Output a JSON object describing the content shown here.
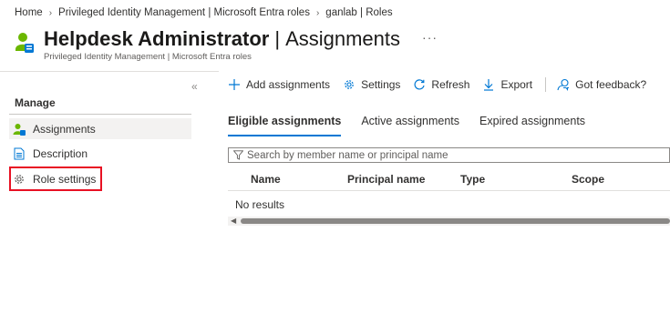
{
  "breadcrumb": {
    "items": [
      "Home",
      "Privileged Identity Management | Microsoft Entra roles",
      "ganlab | Roles"
    ],
    "separator": "›"
  },
  "header": {
    "title_strong": "Helpdesk Administrator",
    "title_pipe": "|",
    "title_rest": "Assignments",
    "more": "···",
    "subtitle": "Privileged Identity Management | Microsoft Entra roles"
  },
  "sidebar": {
    "collapse": "«",
    "manage_label": "Manage",
    "items": [
      {
        "label": "Assignments",
        "icon": "user-group-icon"
      },
      {
        "label": "Description",
        "icon": "document-icon"
      },
      {
        "label": "Role settings",
        "icon": "gear-icon"
      }
    ]
  },
  "toolbar": {
    "add": "Add assignments",
    "settings": "Settings",
    "refresh": "Refresh",
    "export": "Export",
    "feedback": "Got feedback?"
  },
  "tabs": [
    "Eligible assignments",
    "Active assignments",
    "Expired assignments"
  ],
  "search": {
    "placeholder": "Search by member name or principal name"
  },
  "table": {
    "columns": [
      "Name",
      "Principal name",
      "Type",
      "Scope"
    ],
    "empty": "No results"
  },
  "colors": {
    "accent": "#0078d4",
    "highlight": "#e81123",
    "icon_green": "#6bb700"
  }
}
